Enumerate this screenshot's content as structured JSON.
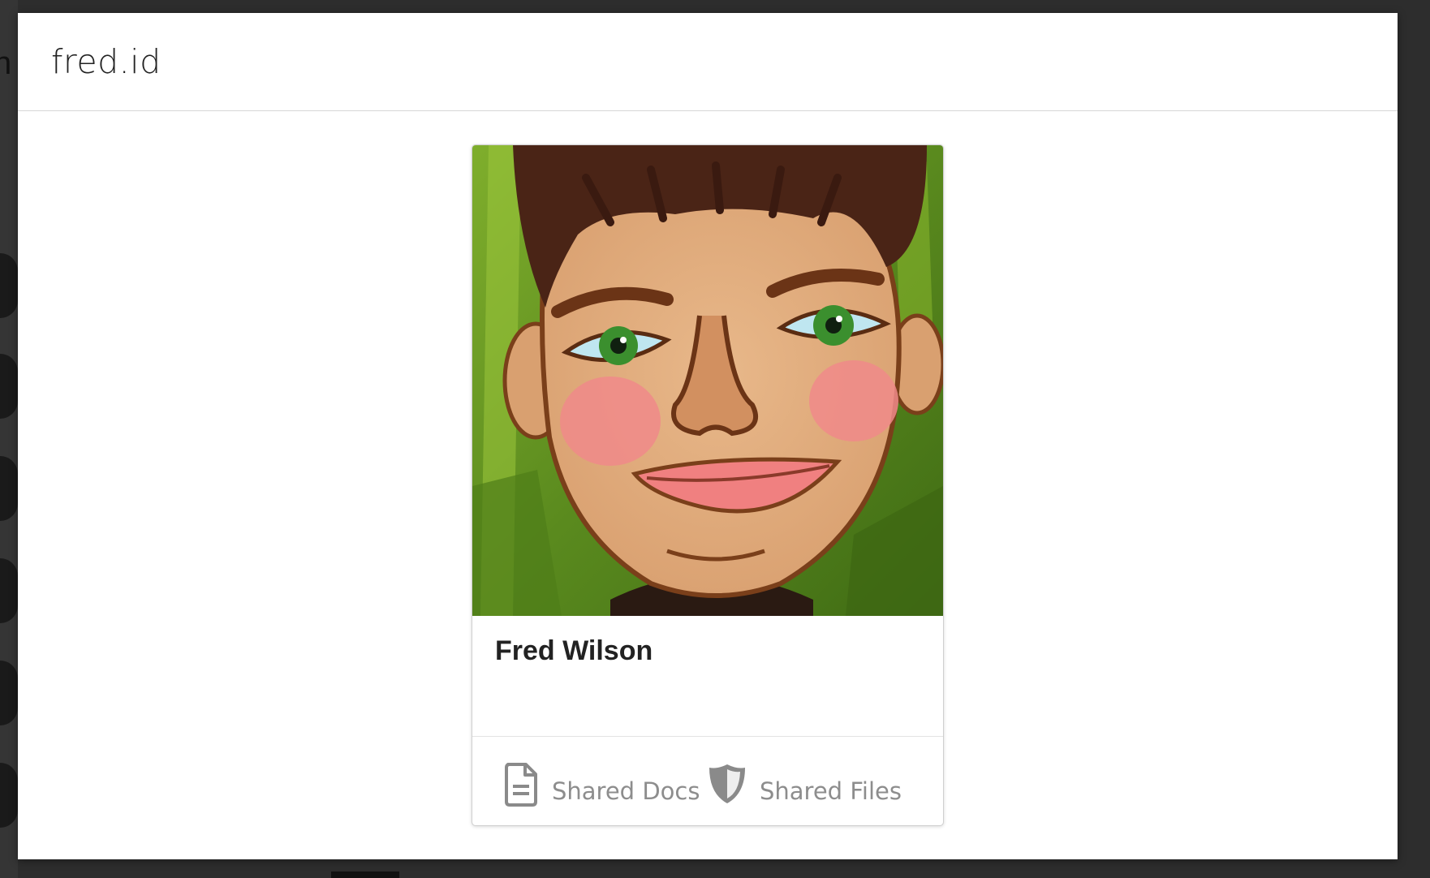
{
  "modal": {
    "title": "fred.id"
  },
  "profile": {
    "name": "Fred Wilson",
    "image_alt": "Painted portrait of Fred Wilson"
  },
  "footer": {
    "docs_label": "Shared Docs",
    "files_label": "Shared Files",
    "docs_icon": "document-icon",
    "files_icon": "shield-icon",
    "link_color": "#8d8d8d"
  },
  "background": {
    "partial_letter": "n"
  }
}
